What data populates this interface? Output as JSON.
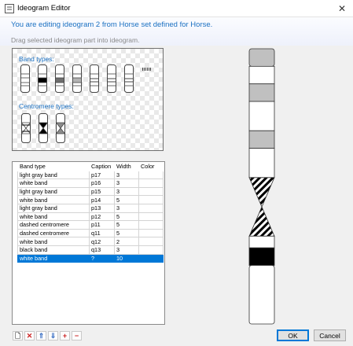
{
  "window": {
    "title": "Ideogram Editor",
    "close_label": "✕"
  },
  "header": {
    "title": "You are editing ideogram 2 from Horse set defined for Horse.",
    "subtitle": "Drag selected ideogram part into ideogram."
  },
  "palette": {
    "band_types_label": "Band types:",
    "centromere_types_label": "Centromere types:",
    "band_types": [
      {
        "icon": "white-band-icon",
        "fill": "#ffffff"
      },
      {
        "icon": "black-band-icon",
        "fill": "#000000"
      },
      {
        "icon": "dark-gray-band-icon",
        "fill": "#6e6e6e"
      },
      {
        "icon": "light-gray-band-icon",
        "fill": "#b4b4b4"
      },
      {
        "icon": "lined-band-icon",
        "fill": "lines"
      },
      {
        "icon": "thin-lined-band-icon",
        "fill": "lines"
      },
      {
        "icon": "double-lined-band-icon",
        "fill": "lines"
      },
      {
        "icon": "stalk-band-icon",
        "fill": "stalk"
      }
    ],
    "centromere_types": [
      {
        "icon": "dashed-centromere-icon",
        "fill": "dashed"
      },
      {
        "icon": "black-centromere-icon",
        "fill": "#000000"
      },
      {
        "icon": "gray-centromere-icon",
        "fill": "#8c8c8c"
      }
    ]
  },
  "grid": {
    "columns": [
      "Band type",
      "Caption",
      "Width",
      "Color"
    ],
    "rows": [
      [
        "light gray band",
        "p17",
        "3",
        ""
      ],
      [
        "white band",
        "p16",
        "3",
        ""
      ],
      [
        "light gray band",
        "p15",
        "3",
        ""
      ],
      [
        "white band",
        "p14",
        "5",
        ""
      ],
      [
        "light gray band",
        "p13",
        "3",
        ""
      ],
      [
        "white band",
        "p12",
        "5",
        ""
      ],
      [
        "dashed centromere",
        "p11",
        "5",
        ""
      ],
      [
        "dashed centromere",
        "q11",
        "5",
        ""
      ],
      [
        "white band",
        "q12",
        "2",
        ""
      ],
      [
        "black band",
        "q13",
        "3",
        ""
      ],
      [
        "white band",
        "?",
        "10",
        ""
      ]
    ],
    "selected_row_index": 10
  },
  "ideogram": {
    "segments": [
      {
        "kind": "band",
        "fill": "#c0c0c0",
        "units": 3,
        "cap": "top"
      },
      {
        "kind": "band",
        "fill": "#ffffff",
        "units": 3
      },
      {
        "kind": "band",
        "fill": "#c0c0c0",
        "units": 3
      },
      {
        "kind": "band",
        "fill": "#ffffff",
        "units": 5
      },
      {
        "kind": "band",
        "fill": "#c0c0c0",
        "units": 3
      },
      {
        "kind": "band",
        "fill": "#ffffff",
        "units": 5
      },
      {
        "kind": "centromere-top",
        "fill": "dashed",
        "units": 5
      },
      {
        "kind": "centromere-bottom",
        "fill": "dashed",
        "units": 5
      },
      {
        "kind": "band",
        "fill": "#ffffff",
        "units": 2
      },
      {
        "kind": "band",
        "fill": "#000000",
        "units": 3
      },
      {
        "kind": "band",
        "fill": "#ffffff",
        "units": 10,
        "cap": "bottom"
      }
    ]
  },
  "toolbar": {
    "buttons": [
      {
        "icon": "new-document-icon",
        "glyph": "🗋",
        "color": "#444444"
      },
      {
        "icon": "delete-icon",
        "glyph": "✕",
        "color": "#cc2222"
      },
      {
        "icon": "move-up-icon",
        "glyph": "⇑",
        "color": "#3a6fc4"
      },
      {
        "icon": "move-down-icon",
        "glyph": "⇓",
        "color": "#3a6fc4"
      },
      {
        "icon": "add-icon",
        "glyph": "+",
        "color": "#cc2222"
      },
      {
        "icon": "remove-icon",
        "glyph": "−",
        "color": "#cc2222"
      }
    ]
  },
  "buttons": {
    "ok_label": "OK",
    "cancel_label": "Cancel"
  }
}
